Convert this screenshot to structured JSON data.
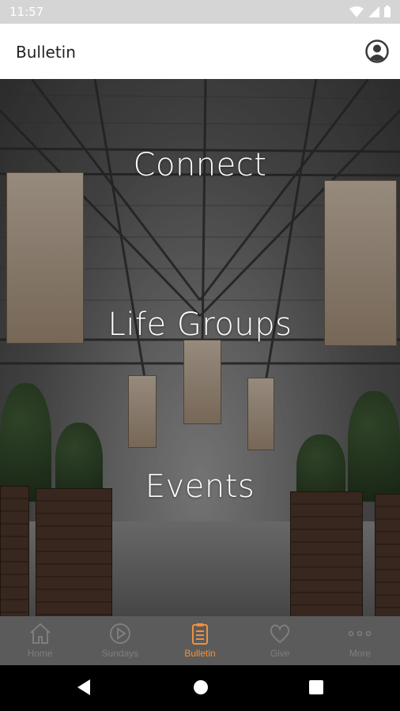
{
  "status_bar": {
    "time": "11:57"
  },
  "app_bar": {
    "title": "Bulletin"
  },
  "hero": {
    "links": [
      "Connect",
      "Life Groups",
      "Events"
    ]
  },
  "tabs": [
    {
      "label": "Home",
      "icon": "home-icon"
    },
    {
      "label": "Sundays",
      "icon": "play-circle-icon"
    },
    {
      "label": "Bulletin",
      "icon": "clipboard-icon",
      "active": true
    },
    {
      "label": "Give",
      "icon": "heart-icon"
    },
    {
      "label": "More",
      "icon": "more-dots-icon"
    }
  ],
  "colors": {
    "accent": "#f0913a",
    "tab_inactive": "#7e7e7e",
    "tab_bar_bg": "#5b5b5b"
  }
}
